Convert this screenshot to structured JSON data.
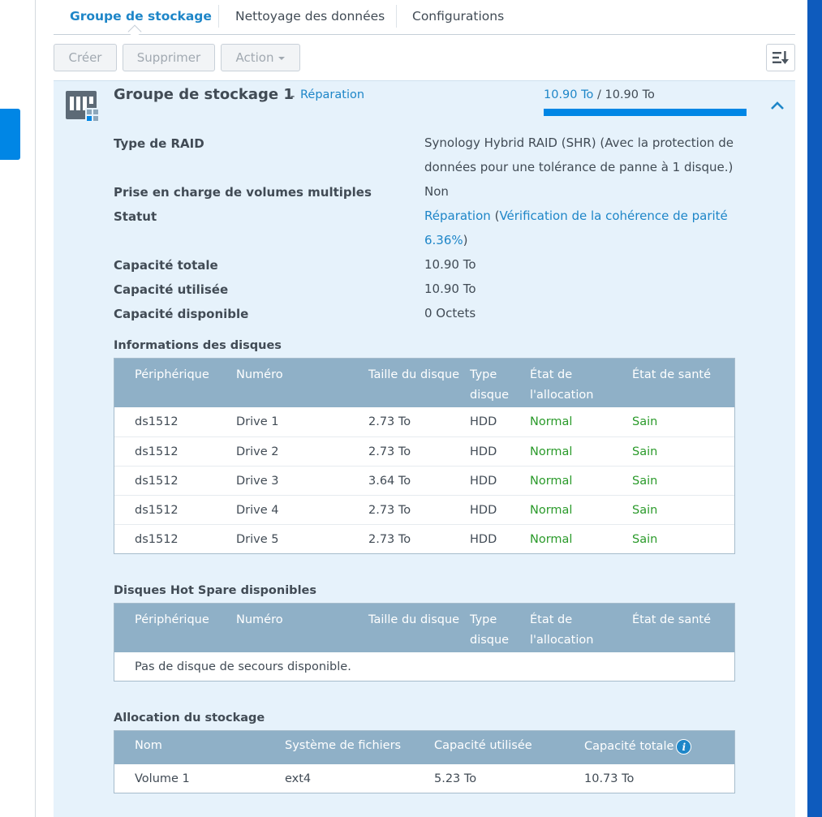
{
  "tabs": [
    {
      "label": "Groupe de stockage"
    },
    {
      "label": "Nettoyage des données"
    },
    {
      "label": "Configurations"
    }
  ],
  "toolbar": {
    "create_label": "Créer",
    "delete_label": "Supprimer",
    "action_label": "Action"
  },
  "pool": {
    "title": "Groupe de stockage 1",
    "separator": "-",
    "status": "Réparation",
    "capacity_used": "10.90 To",
    "capacity_sep": "/",
    "capacity_total": "10.90 To",
    "capacity_fraction": 1.0
  },
  "props": {
    "raid_type_label": "Type de RAID",
    "raid_type_value": "Synology Hybrid RAID (SHR) (Avec la protection de données pour une tolérance de panne à 1 disque.)",
    "multi_volume_label": "Prise en charge de volumes multiples",
    "multi_volume_value": "Non",
    "status_label": "Statut",
    "status_value": "Réparation",
    "status_paren_open": "(",
    "status_detail": "Vérification de la cohérence de parité 6.36%",
    "status_paren_close": ")",
    "total_label": "Capacité totale",
    "total_value": "10.90 To",
    "used_label": "Capacité utilisée",
    "used_value": "10.90 To",
    "free_label": "Capacité disponible",
    "free_value": "0 Octets"
  },
  "disks": {
    "title": "Informations des disques",
    "headers": [
      "Périphérique",
      "Numéro",
      "Taille du disque",
      "Type disque",
      "État de l'allocation",
      "État de santé"
    ],
    "rows": [
      [
        "ds1512",
        "Drive 1",
        "2.73 To",
        "HDD",
        "Normal",
        "Sain"
      ],
      [
        "ds1512",
        "Drive 2",
        "2.73 To",
        "HDD",
        "Normal",
        "Sain"
      ],
      [
        "ds1512",
        "Drive 3",
        "3.64 To",
        "HDD",
        "Normal",
        "Sain"
      ],
      [
        "ds1512",
        "Drive 4",
        "2.73 To",
        "HDD",
        "Normal",
        "Sain"
      ],
      [
        "ds1512",
        "Drive 5",
        "2.73 To",
        "HDD",
        "Normal",
        "Sain"
      ]
    ]
  },
  "hotspare": {
    "title": "Disques Hot Spare disponibles",
    "headers": [
      "Périphérique",
      "Numéro",
      "Taille du disque",
      "Type disque",
      "État de l'allocation",
      "État de santé"
    ],
    "empty": "Pas de disque de secours disponible."
  },
  "allocation": {
    "title": "Allocation du stockage",
    "headers": [
      "Nom",
      "Système de fichiers",
      "Capacité utilisée",
      "Capacité totale"
    ],
    "info_glyph": "i",
    "rows": [
      [
        "Volume 1",
        "ext4",
        "5.23 To",
        "10.73 To"
      ]
    ]
  },
  "colors": {
    "accent": "#1e86c8",
    "panel_bg": "#e6f2fb",
    "header_bg": "#8fb0c7",
    "ok": "#2a9a2a"
  }
}
